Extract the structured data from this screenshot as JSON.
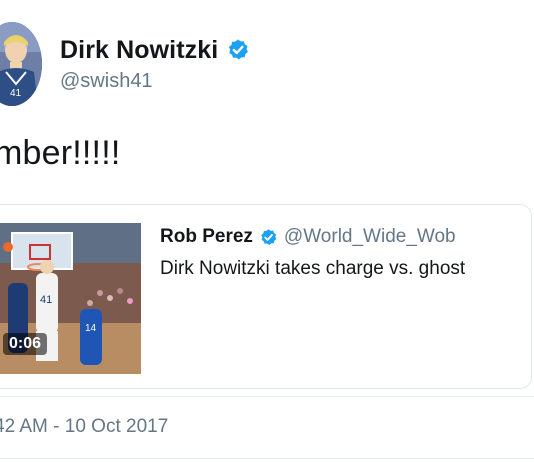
{
  "author": {
    "display_name": "Dirk Nowitzki",
    "handle": "@swish41",
    "verified": true,
    "avatar_icon": "player-avatar"
  },
  "tweet": {
    "text": "mber!!!!!",
    "timestamp": "42 AM - 10 Oct 2017"
  },
  "quoted_tweet": {
    "display_name": "Rob Perez",
    "handle": "@World_Wide_Wob",
    "verified": true,
    "text": "Dirk Nowitzki takes charge vs. ghost",
    "media_duration": "0:06"
  },
  "colors": {
    "verified_blue": "#1da1f2",
    "text_primary": "#14171a",
    "text_secondary": "#657786",
    "border": "#e1e8ed"
  }
}
